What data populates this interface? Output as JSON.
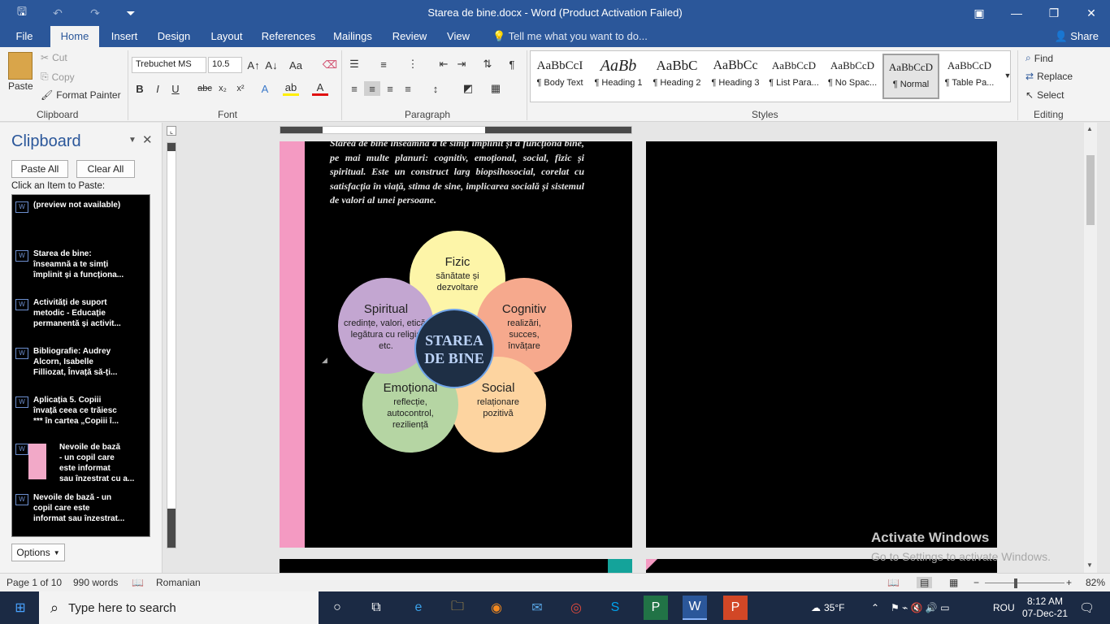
{
  "window": {
    "title": "Starea de bine.docx - Word (Product Activation Failed)",
    "minimize_glyph": "—",
    "restore_glyph": "❐",
    "close_glyph": "✕",
    "ribbon_display_glyph": "▣"
  },
  "qat": {
    "save_glyph": "🖫",
    "undo_glyph": "↶",
    "redo_glyph": "↷",
    "customize_glyph": "⏷"
  },
  "tabs": [
    "File",
    "Home",
    "Insert",
    "Design",
    "Layout",
    "References",
    "Mailings",
    "Review",
    "View"
  ],
  "tell_me": "💡 Tell me what you want to do...",
  "share": "👤 Share",
  "clipboard_group": {
    "label": "Clipboard",
    "paste": "Paste",
    "cut": "Cut",
    "copy": "Copy",
    "format_painter": "Format Painter"
  },
  "font_group": {
    "label": "Font",
    "font_name": "Trebuchet MS",
    "font_size": "10.5"
  },
  "paragraph_group": {
    "label": "Paragraph"
  },
  "styles_group": {
    "label": "Styles",
    "items": [
      {
        "preview": "AaBbCcI",
        "name": "¶ Body Text"
      },
      {
        "preview": "AaBb",
        "name": "¶ Heading 1"
      },
      {
        "preview": "AaBbC",
        "name": "¶ Heading 2"
      },
      {
        "preview": "AaBbCc",
        "name": "¶ Heading 3"
      },
      {
        "preview": "AaBbCcD",
        "name": "¶ List Para..."
      },
      {
        "preview": "AaBbCcD",
        "name": "¶ No Spac..."
      },
      {
        "preview": "AaBbCcD",
        "name": "¶ Normal"
      },
      {
        "preview": "AaBbCcD",
        "name": "¶ Table Pa..."
      }
    ]
  },
  "editing_group": {
    "label": "Editing",
    "find": "Find",
    "replace": "Replace",
    "select": "Select"
  },
  "clipboard_pane": {
    "title": "Clipboard",
    "paste_all": "Paste All",
    "clear_all": "Clear All",
    "hint": "Click an Item to Paste:",
    "items": [
      "(preview not available)",
      "Starea de bine:\nînseamnă a te simți\nîmplinit și a funcționa...",
      "Activități de suport\nmetodic - Educație\npermanentă și activit...",
      "Bibliografie: Audrey\nAlcorn, Isabelle\nFilliozat, Învață să-ți...",
      "Aplicația 5. Copiii\nînvață ceea ce trăiesc\n*** în cartea „Copiii î...",
      "Nevoile de bază\n- un copil care\neste informat\nsau înzestrat cu a...",
      "Nevoile de bază - un\ncopil care este\ninformat sau înzestrat..."
    ],
    "options": "Options"
  },
  "document": {
    "paragraph": "Starea de bine înseamnă a te simți împlinit și a funcționa bine, pe mai multe planuri: cognitiv, emoțional, social, fizic și spiritual. Este un construct larg biopsihosocial, corelat cu satisfacția în viață, stima de sine, implicarea socială și sistemul de valori al unei persoane.",
    "diagram": {
      "center": "STAREA DE BINE",
      "petals": [
        {
          "title": "Fizic",
          "desc": "sănătate și dezvoltare",
          "color": "#fdf5a8"
        },
        {
          "title": "Cognitiv",
          "desc": "realizări, succes, învățare",
          "color": "#f6a98d"
        },
        {
          "title": "Social",
          "desc": "relaționare pozitivă",
          "color": "#fdd4a0"
        },
        {
          "title": "Emoțional",
          "desc": "reflecție, autocontrol, reziliență",
          "color": "#b5d5a3"
        },
        {
          "title": "Spiritual",
          "desc": "credințe, valori, etică, legătura cu religia etc.",
          "color": "#c3a6d1"
        }
      ]
    },
    "watermark_title": "Activate Windows",
    "watermark_sub": "Go to Settings to activate Windows."
  },
  "status": {
    "page": "Page 1 of 10",
    "words": "990 words",
    "language": "Romanian",
    "zoom": "82%"
  },
  "taskbar": {
    "search_placeholder": "Type here to search",
    "weather": "35°F",
    "language": "ROU",
    "time": "8:12 AM",
    "date": "07-Dec-21"
  },
  "colors": {
    "word_blue": "#2b579a",
    "margin_pink": "#f49ac2",
    "teal": "#14a39a"
  }
}
